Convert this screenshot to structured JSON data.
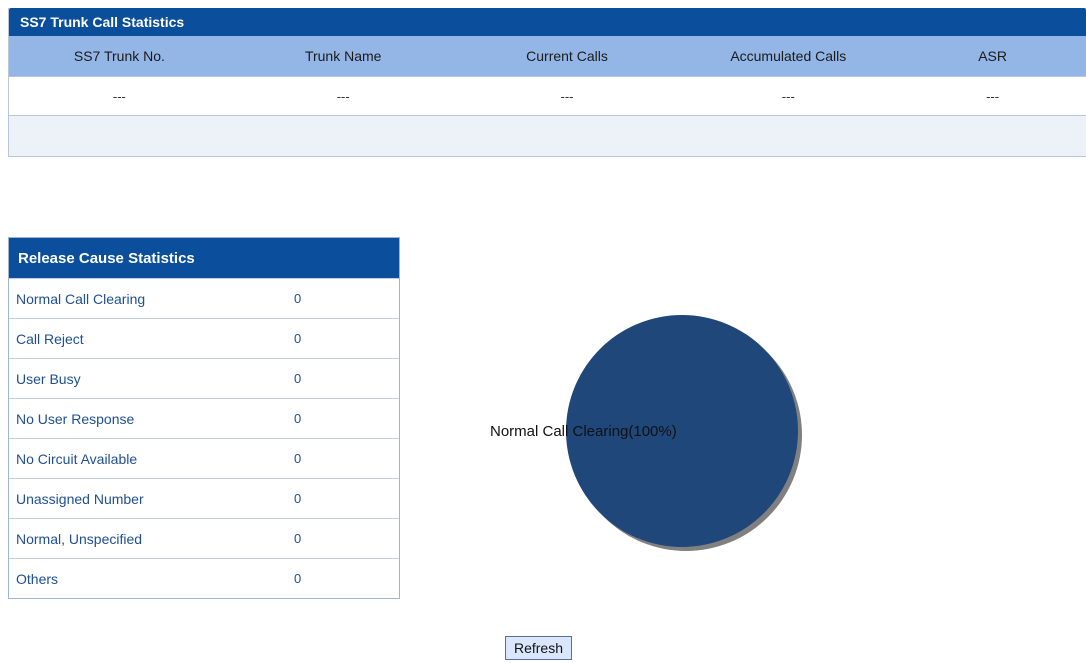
{
  "trunk_stats": {
    "title": "SS7 Trunk Call Statistics",
    "columns": [
      "SS7 Trunk No.",
      "Trunk Name",
      "Current Calls",
      "Accumulated Calls",
      "ASR"
    ],
    "rows": [
      [
        "---",
        "---",
        "---",
        "---",
        "---"
      ]
    ]
  },
  "release_stats": {
    "title": "Release Cause Statistics",
    "items": [
      {
        "label": "Normal Call Clearing",
        "count": "0"
      },
      {
        "label": "Call Reject",
        "count": "0"
      },
      {
        "label": "User Busy",
        "count": "0"
      },
      {
        "label": "No User Response",
        "count": "0"
      },
      {
        "label": "No Circuit Available",
        "count": "0"
      },
      {
        "label": "Unassigned Number",
        "count": "0"
      },
      {
        "label": "Normal, Unspecified",
        "count": "0"
      },
      {
        "label": "Others",
        "count": "0"
      }
    ]
  },
  "chart_data": {
    "type": "pie",
    "slices": [
      {
        "label": "Normal Call Clearing(100%)",
        "percent": 100,
        "color": "#1f477a"
      }
    ],
    "shadow_color": "#808080"
  },
  "actions": {
    "refresh_label": "Refresh"
  }
}
